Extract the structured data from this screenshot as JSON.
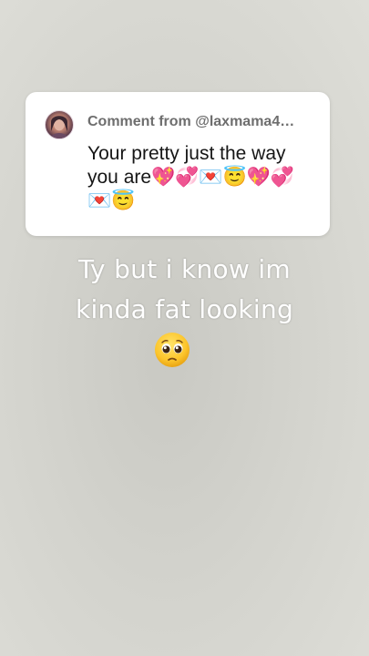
{
  "comment": {
    "header": "Comment from @laxmama4…",
    "text": "Your pretty just the way you are💖💞💌😇💖💞💌😇"
  },
  "caption": {
    "line1": "Ty but i know im",
    "line2": "kinda fat looking"
  },
  "icons": {
    "avatar": "user-avatar",
    "reaction": "pleading-face-emoji"
  }
}
